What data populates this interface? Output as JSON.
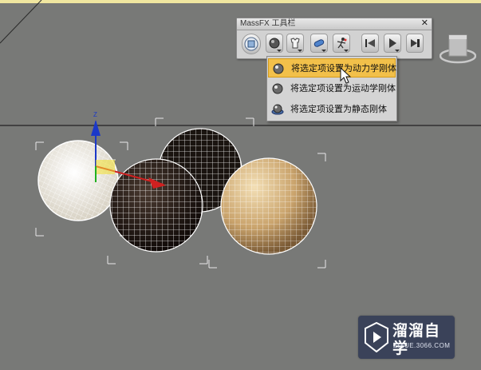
{
  "toolbar": {
    "title": "MassFX 工具栏",
    "close_glyph": "✕",
    "buttons": [
      {
        "icon": "world-settings-icon"
      },
      {
        "icon": "rigid-body-icon"
      },
      {
        "icon": "cloth-icon"
      },
      {
        "icon": "constraint-icon"
      },
      {
        "icon": "ragdoll-icon"
      },
      {
        "icon": "reset-simulation-icon"
      },
      {
        "icon": "play-simulation-icon"
      },
      {
        "icon": "step-simulation-icon"
      }
    ]
  },
  "menu": {
    "items": [
      {
        "label": "将选定项设置为动力学刚体",
        "icon": "dynamic-rigid-body-icon",
        "highlighted": true
      },
      {
        "label": "将选定项设置为运动学刚体",
        "icon": "kinematic-rigid-body-icon",
        "highlighted": false
      },
      {
        "label": "将选定项设置为静态刚体",
        "icon": "static-rigid-body-icon",
        "highlighted": false
      }
    ]
  },
  "gizmo": {
    "axis_label": "Z"
  },
  "watermark": {
    "name": "溜溜自学",
    "url": "ZIXUE.3066.COM"
  },
  "colors": {
    "viewport": "#787977",
    "highlight": "#f2c04a",
    "watermark_bg": "#3a4259"
  }
}
